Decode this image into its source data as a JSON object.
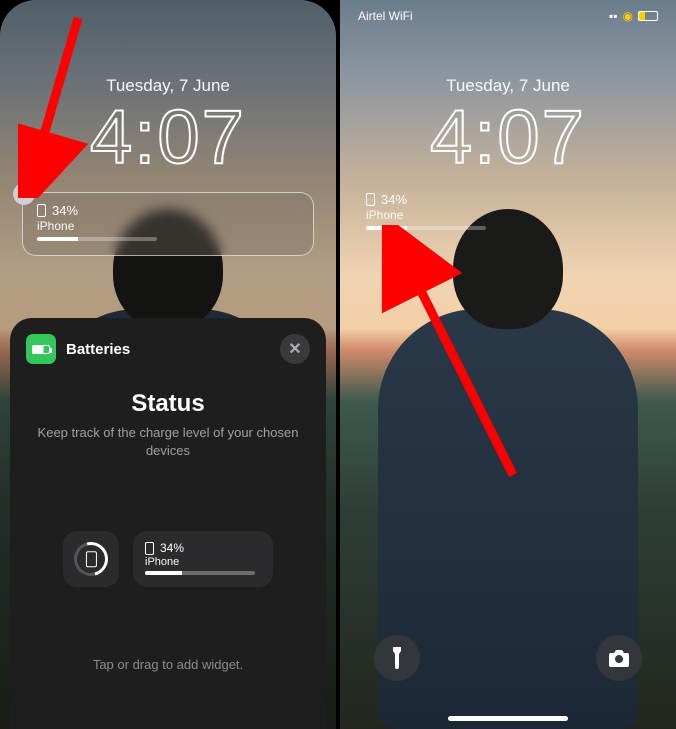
{
  "carrier": "Airtel WiFi",
  "date": "Tuesday, 7 June",
  "time": "4:07",
  "battery": {
    "percent_label": "34%",
    "device": "iPhone",
    "percent_value": 34
  },
  "sheet": {
    "app_name": "Batteries",
    "title": "Status",
    "description": "Keep track of the charge level of your chosen devices",
    "hint": "Tap or drag to add widget."
  }
}
